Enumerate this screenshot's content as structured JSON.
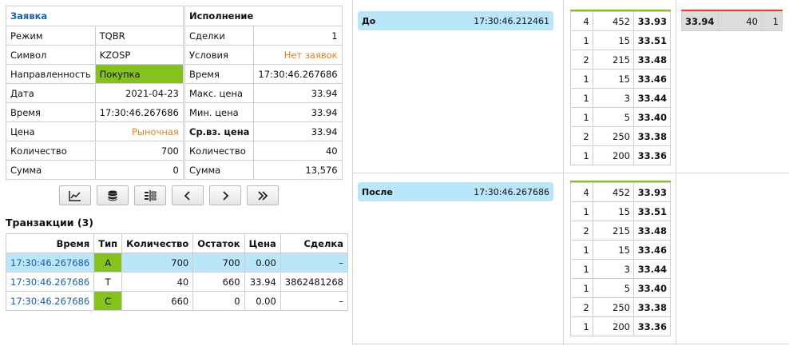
{
  "order": {
    "title": "Заявка",
    "rows": [
      {
        "label": "Режим",
        "value": "TQBR"
      },
      {
        "label": "Символ",
        "value": "KZOSP"
      },
      {
        "label": "Направленность",
        "value": "Покупка"
      },
      {
        "label": "Дата",
        "value": "2021-04-23"
      },
      {
        "label": "Время",
        "value": "17:30:46.267686"
      },
      {
        "label": "Цена",
        "value": "Рыночная"
      },
      {
        "label": "Количество",
        "value": "700"
      },
      {
        "label": "Сумма",
        "value": "0"
      }
    ]
  },
  "execution": {
    "title": "Исполнение",
    "rows": [
      {
        "label": "Сделки",
        "value": "1"
      },
      {
        "label": "Условия",
        "value": "Нет заявок"
      },
      {
        "label": "Время",
        "value": "17:30:46.267686"
      },
      {
        "label": "Макс. цена",
        "value": "33.94"
      },
      {
        "label": "Мин. цена",
        "value": "33.94"
      },
      {
        "label": "Ср.вз. цена",
        "value": "33.94"
      },
      {
        "label": "Количество",
        "value": "40"
      },
      {
        "label": "Сумма",
        "value": "13,576"
      }
    ]
  },
  "toolbar": {
    "buttons": [
      "chart-icon",
      "database-icon",
      "split-view-icon",
      "chevron-left-icon",
      "chevron-right-icon",
      "double-chevron-right-icon"
    ]
  },
  "transactions": {
    "title": "Транзакции",
    "count": "(3)",
    "columns": [
      "Время",
      "Тип",
      "Количество",
      "Остаток",
      "Цена",
      "Сделка"
    ],
    "rows": [
      {
        "time": "17:30:46.267686",
        "type": "A",
        "qty": "700",
        "rest": "700",
        "price": "0.00",
        "deal": "–"
      },
      {
        "time": "17:30:46.267686",
        "type": "T",
        "qty": "40",
        "rest": "660",
        "price": "33.94",
        "deal": "3862481268"
      },
      {
        "time": "17:30:46.267686",
        "type": "C",
        "qty": "660",
        "rest": "0",
        "price": "0.00",
        "deal": "–"
      }
    ]
  },
  "before": {
    "label": "До",
    "time": "17:30:46.212461",
    "bids": [
      {
        "count": "4",
        "volume": "452",
        "price": "33.93"
      },
      {
        "count": "1",
        "volume": "15",
        "price": "33.51"
      },
      {
        "count": "2",
        "volume": "215",
        "price": "33.48"
      },
      {
        "count": "1",
        "volume": "15",
        "price": "33.46"
      },
      {
        "count": "1",
        "volume": "3",
        "price": "33.44"
      },
      {
        "count": "1",
        "volume": "5",
        "price": "33.40"
      },
      {
        "count": "2",
        "volume": "250",
        "price": "33.38"
      },
      {
        "count": "1",
        "volume": "200",
        "price": "33.36"
      }
    ],
    "asks": [
      {
        "price": "33.94",
        "volume": "40",
        "count": "1"
      }
    ]
  },
  "after": {
    "label": "После",
    "time": "17:30:46.267686",
    "bids": [
      {
        "count": "4",
        "volume": "452",
        "price": "33.93"
      },
      {
        "count": "1",
        "volume": "15",
        "price": "33.51"
      },
      {
        "count": "2",
        "volume": "215",
        "price": "33.48"
      },
      {
        "count": "1",
        "volume": "15",
        "price": "33.46"
      },
      {
        "count": "1",
        "volume": "3",
        "price": "33.44"
      },
      {
        "count": "1",
        "volume": "5",
        "price": "33.40"
      },
      {
        "count": "2",
        "volume": "250",
        "price": "33.38"
      },
      {
        "count": "1",
        "volume": "200",
        "price": "33.36"
      }
    ]
  },
  "colors": {
    "accent_blue": "#1f5fa8",
    "buy_green": "#84c21c",
    "market_orange": "#e8821e",
    "highlight_row": "#b9e6f8",
    "ask_red": "#e8412c"
  }
}
